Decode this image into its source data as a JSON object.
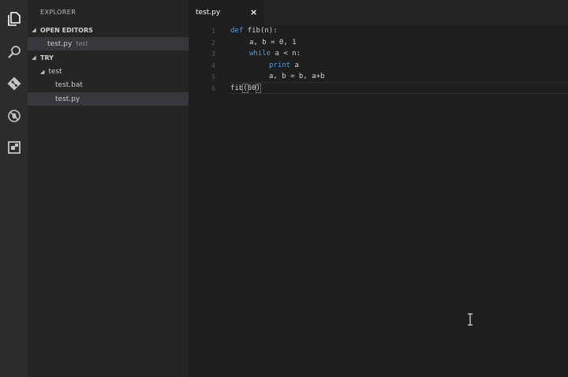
{
  "explorer": {
    "title": "EXPLORER",
    "open_editors": {
      "header": "OPEN EDITORS",
      "items": [
        {
          "label": "test.py",
          "description": "test"
        }
      ]
    },
    "workspace": {
      "header": "TRY",
      "folder": "test",
      "files": [
        "test.bat",
        "test.py"
      ]
    }
  },
  "editor": {
    "tab_label": "test.py",
    "tab_close": "×",
    "line_numbers": [
      "1",
      "2",
      "3",
      "4",
      "5",
      "6"
    ],
    "code": {
      "l1_kw": "def",
      "l1_rest": " fib(n):",
      "l2": "a, b = 0, 1",
      "l3_kw": "while",
      "l3_rest": " a < n:",
      "l4_kw": "print",
      "l4_rest": " a",
      "l5": "a, b = b, a+b",
      "l6_name": "fib",
      "l6_open": "(",
      "l6_arg": "60",
      "l6_close": ")"
    }
  },
  "icons": {
    "activity_bar": [
      "files-icon",
      "search-icon",
      "git-icon",
      "debug-icon",
      "extensions-icon"
    ]
  },
  "colors": {
    "keyword": "#569cd6",
    "editor_bg": "#1e1e1e",
    "sidebar_bg": "#252526",
    "activity_bg": "#2c2c2c"
  }
}
